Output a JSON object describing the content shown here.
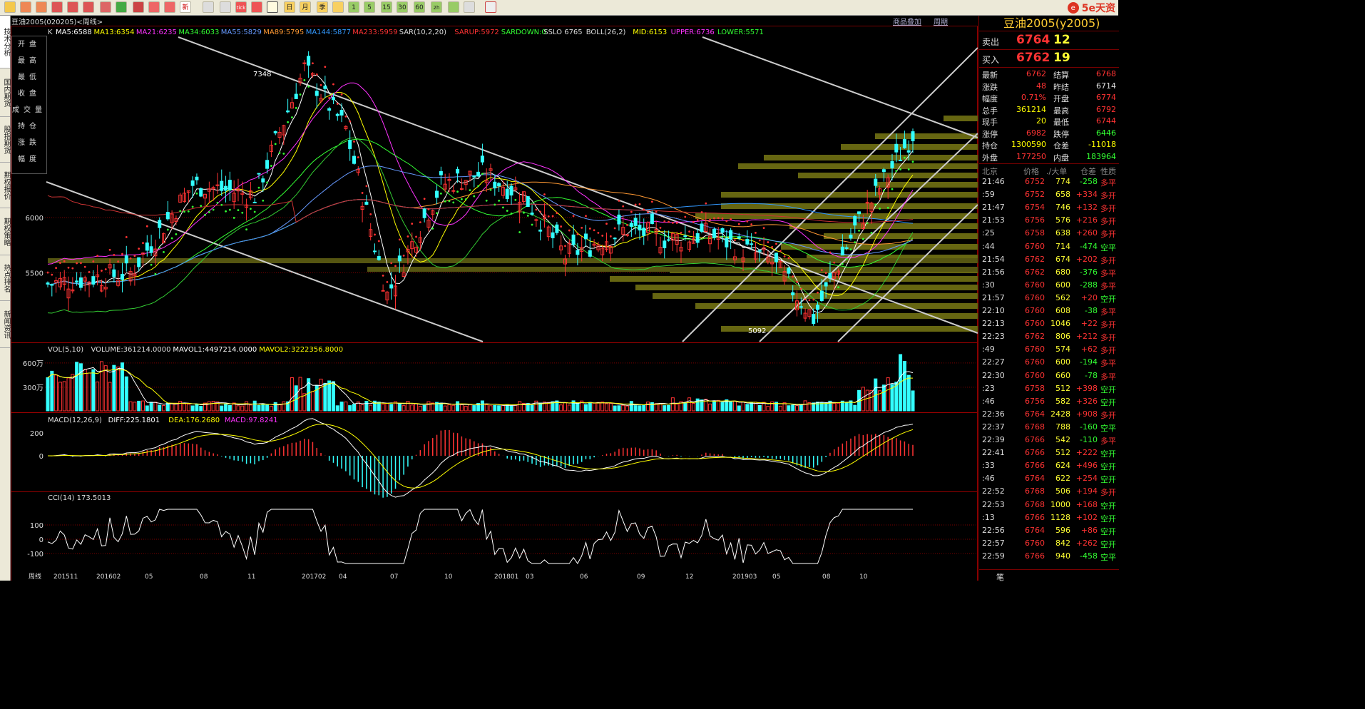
{
  "toolbar": {
    "buttons": [
      "home",
      "back",
      "forward",
      "search",
      "zoom-in",
      "zoom-out",
      "window",
      "paint",
      "filter",
      "new",
      "table",
      "line",
      "tick",
      "day",
      "month",
      "season",
      "x",
      "1",
      "5",
      "15",
      "30",
      "60",
      "4h",
      "check",
      "doc"
    ],
    "day_button": "日",
    "month_button": "月",
    "season_button": "季",
    "new_label": "新",
    "tick_label": "tick",
    "btn_1": "1",
    "btn_5": "5",
    "btn_15": "15",
    "btn_30": "30",
    "btn_60": "60",
    "btn_2h": "2h"
  },
  "logo": {
    "text": "5e天资"
  },
  "side_tabs": [
    "技术分析",
    "国内期货",
    "股指期货",
    "期权报价",
    "期权策略",
    "热点排名",
    "新闻资讯"
  ],
  "chart": {
    "title": "豆油2005(020205)<周线>",
    "link_overlay": "商品叠加",
    "link_period": "周期",
    "ma_line": [
      {
        "t": "K",
        "c": "#dddddd"
      },
      {
        "t": "MA5:6588",
        "c": "#ffffff"
      },
      {
        "t": "MA13:6354",
        "c": "#ffff00"
      },
      {
        "t": "MA21:6235",
        "c": "#ff33ff"
      },
      {
        "t": "MA34:6033",
        "c": "#33ff33"
      },
      {
        "t": "MA55:5829",
        "c": "#6699ff"
      },
      {
        "t": "MA89:5795",
        "c": "#ff9933"
      },
      {
        "t": "MA144:5877",
        "c": "#3399ff"
      },
      {
        "t": "MA233:5959",
        "c": "#ff3333"
      },
      {
        "t": "SAR(10,2,20)",
        "c": "#dddddd"
      },
      {
        "t": "SARUP:5972",
        "c": "#ff3333"
      },
      {
        "t": "SARDOWN:0",
        "c": "#33ff33"
      },
      {
        "t": "SSLO 6765",
        "c": "#dddddd"
      },
      {
        "t": "BOLL(26,2)",
        "c": "#dddddd"
      },
      {
        "t": "MID:6153",
        "c": "#ffff00"
      },
      {
        "t": "UPPER:6736",
        "c": "#ff33ff"
      },
      {
        "t": "LOWER:5571",
        "c": "#33ff33"
      }
    ],
    "y_labels": [
      "6000",
      "5500"
    ],
    "high_label": "7348",
    "low_label": "5092",
    "info_rows": [
      "开盘",
      "最高",
      "最低",
      "收盘",
      "成交量",
      "持仓",
      "涨跌",
      "幅度"
    ],
    "vol_header": [
      {
        "t": "VOL(5,10)",
        "c": "#dddddd"
      },
      {
        "t": "VOLUME:361214.0000",
        "c": "#dddddd"
      },
      {
        "t": "MAVOL1:4497214.0000",
        "c": "#ffffff"
      },
      {
        "t": "MAVOL2:3222356.8000",
        "c": "#ffff00"
      }
    ],
    "vol_y": [
      "600万",
      "300万"
    ],
    "macd_header": [
      {
        "t": "MACD(12,26,9)",
        "c": "#dddddd"
      },
      {
        "t": "DIFF:225.1801",
        "c": "#ffffff"
      },
      {
        "t": "DEA:176.2680",
        "c": "#ffff00"
      },
      {
        "t": "MACD:97.8241",
        "c": "#ff33ff"
      }
    ],
    "macd_y": [
      "200",
      "0"
    ],
    "cci_header": [
      {
        "t": "CCI(14)  173.5013",
        "c": "#dddddd"
      }
    ],
    "cci_y": [
      "100",
      "0",
      "-100"
    ],
    "x_axis": [
      "周线",
      "201511",
      "201602",
      "05",
      "08",
      "11",
      "201702",
      "04",
      "07",
      "10",
      "201801",
      "03",
      "06",
      "09",
      "12",
      "201903",
      "05",
      "08",
      "10"
    ]
  },
  "quote": {
    "title": "豆油2005(y2005)",
    "ask_label": "卖出",
    "ask_price": "6764",
    "ask_qty": "12",
    "bid_label": "买入",
    "bid_price": "6762",
    "bid_qty": "19",
    "rows": [
      {
        "l1": "最新",
        "v1": "6762",
        "c1": "#ff3333",
        "l2": "结算",
        "v2": "6768",
        "c2": "#ff3333"
      },
      {
        "l1": "涨跌",
        "v1": "48",
        "c1": "#ff3333",
        "l2": "昨结",
        "v2": "6714",
        "c2": "#dddddd"
      },
      {
        "l1": "幅度",
        "v1": "0.71%",
        "c1": "#ff3333",
        "l2": "开盘",
        "v2": "6774",
        "c2": "#ff3333"
      },
      {
        "l1": "总手",
        "v1": "361214",
        "c1": "#ffff00",
        "l2": "最高",
        "v2": "6792",
        "c2": "#ff3333"
      },
      {
        "l1": "现手",
        "v1": "20",
        "c1": "#ffff00",
        "l2": "最低",
        "v2": "6744",
        "c2": "#ff3333"
      },
      {
        "l1": "涨停",
        "v1": "6982",
        "c1": "#ff3333",
        "l2": "跌停",
        "v2": "6446",
        "c2": "#33ff33"
      },
      {
        "l1": "持仓",
        "v1": "1300590",
        "c1": "#ffff00",
        "l2": "仓差",
        "v2": "-11018",
        "c2": "#ffff00"
      },
      {
        "l1": "外盘",
        "v1": "177250",
        "c1": "#ff3333",
        "l2": "内盘",
        "v2": "183964",
        "c2": "#33ff33"
      }
    ],
    "tick_header": {
      "city": "北京",
      "price": "价格",
      "vol": "./大单",
      "chg": "仓差",
      "nat": "性质"
    },
    "ticks": [
      {
        "t": "21:46",
        "p": "6752",
        "v": "774",
        "c": "-258",
        "n": "多平"
      },
      {
        "t": ":59",
        "p": "6752",
        "v": "658",
        "c": "+334",
        "n": "多开"
      },
      {
        "t": "21:47",
        "p": "6754",
        "v": "746",
        "c": "+132",
        "n": "多开"
      },
      {
        "t": "21:53",
        "p": "6756",
        "v": "576",
        "c": "+216",
        "n": "多开"
      },
      {
        "t": ":25",
        "p": "6758",
        "v": "638",
        "c": "+260",
        "n": "多开"
      },
      {
        "t": ":44",
        "p": "6760",
        "v": "714",
        "c": "-474",
        "n": "空平"
      },
      {
        "t": "21:54",
        "p": "6762",
        "v": "674",
        "c": "+202",
        "n": "多开"
      },
      {
        "t": "21:56",
        "p": "6762",
        "v": "680",
        "c": "-376",
        "n": "多平"
      },
      {
        "t": ":30",
        "p": "6760",
        "v": "600",
        "c": "-288",
        "n": "多平"
      },
      {
        "t": "21:57",
        "p": "6760",
        "v": "562",
        "c": "+20",
        "n": "空开"
      },
      {
        "t": "22:10",
        "p": "6760",
        "v": "608",
        "c": "-38",
        "n": "多平"
      },
      {
        "t": "22:13",
        "p": "6760",
        "v": "1046",
        "c": "+22",
        "n": "多开"
      },
      {
        "t": "22:23",
        "p": "6762",
        "v": "806",
        "c": "+212",
        "n": "多开"
      },
      {
        "t": ":49",
        "p": "6760",
        "v": "574",
        "c": "+62",
        "n": "多开"
      },
      {
        "t": "22:27",
        "p": "6760",
        "v": "600",
        "c": "-194",
        "n": "多平"
      },
      {
        "t": "22:30",
        "p": "6760",
        "v": "660",
        "c": "-78",
        "n": "多平"
      },
      {
        "t": ":23",
        "p": "6758",
        "v": "512",
        "c": "+398",
        "n": "空开"
      },
      {
        "t": ":46",
        "p": "6756",
        "v": "582",
        "c": "+326",
        "n": "空开"
      },
      {
        "t": "22:36",
        "p": "6764",
        "v": "2428",
        "c": "+908",
        "n": "多开"
      },
      {
        "t": "22:37",
        "p": "6768",
        "v": "788",
        "c": "-160",
        "n": "空平"
      },
      {
        "t": "22:39",
        "p": "6766",
        "v": "542",
        "c": "-110",
        "n": "多平"
      },
      {
        "t": "22:41",
        "p": "6766",
        "v": "512",
        "c": "+222",
        "n": "空开"
      },
      {
        "t": ":33",
        "p": "6766",
        "v": "624",
        "c": "+496",
        "n": "空开"
      },
      {
        "t": ":46",
        "p": "6764",
        "v": "622",
        "c": "+254",
        "n": "空开"
      },
      {
        "t": "22:52",
        "p": "6768",
        "v": "506",
        "c": "+194",
        "n": "多开"
      },
      {
        "t": "22:53",
        "p": "6768",
        "v": "1000",
        "c": "+168",
        "n": "空开"
      },
      {
        "t": ":13",
        "p": "6766",
        "v": "1128",
        "c": "+102",
        "n": "空开"
      },
      {
        "t": "22:56",
        "p": "6764",
        "v": "596",
        "c": "+86",
        "n": "空开"
      },
      {
        "t": "22:57",
        "p": "6760",
        "v": "842",
        "c": "+262",
        "n": "空开"
      },
      {
        "t": "22:59",
        "p": "6766",
        "v": "940",
        "c": "-458",
        "n": "空平"
      }
    ],
    "footer": "笔"
  }
}
